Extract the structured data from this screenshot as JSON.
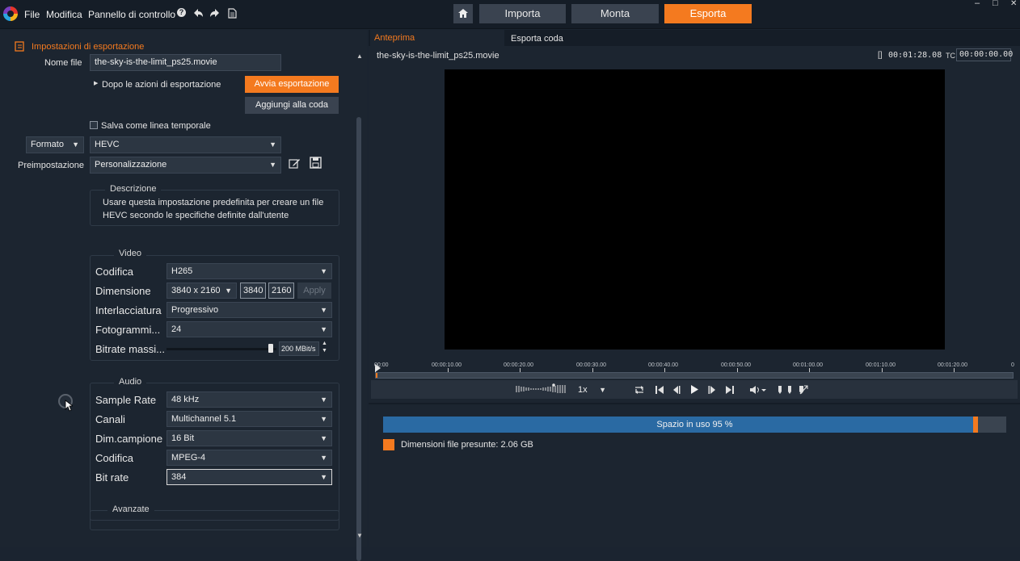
{
  "titlebar": {
    "menu": [
      "File",
      "Modifica",
      "Pannello di controllo"
    ],
    "tabs": [
      {
        "label": "Importa",
        "active": false
      },
      {
        "label": "Monta",
        "active": false
      },
      {
        "label": "Esporta",
        "active": true
      }
    ],
    "window_controls": {
      "minimize": "–",
      "maximize": "□",
      "close": "✕"
    }
  },
  "export_settings": {
    "header": "Impostazioni di esportazione",
    "file_name_label": "Nome file",
    "file_name_value": "the-sky-is-the-limit_ps25.movie",
    "after_export_actions": "Dopo le azioni di esportazione",
    "start_export_button": "Avvia esportazione",
    "add_to_queue_button": "Aggiungi alla coda",
    "save_as_timeline": "Salva come linea temporale",
    "save_as_timeline_checked": false,
    "format_label": "Formato",
    "format_value": "HEVC",
    "preset_label": "Preimpostazione",
    "preset_value": "Personalizzazione",
    "description_title": "Descrizione",
    "description_text_1": "Usare questa impostazione predefinita per creare un file",
    "description_text_2": "HEVC secondo le specifiche definite dall'utente"
  },
  "video": {
    "title": "Video",
    "codec_label": "Codifica",
    "codec_value": "H265",
    "size_label": "Dimensione",
    "size_value": "3840 x 2160",
    "width_value": "3840",
    "height_value": "2160",
    "apply_button": "Apply",
    "interlace_label": "Interlacciatura",
    "interlace_value": "Progressivo",
    "framerate_label": "Fotogrammi...",
    "framerate_value": "24",
    "bitrate_label": "Bitrate massi...",
    "bitrate_value": "200 MBit/s",
    "bitrate_fraction": 0.95
  },
  "audio": {
    "title": "Audio",
    "sample_rate_label": "Sample Rate",
    "sample_rate_value": "48 kHz",
    "channels_label": "Canali",
    "channels_value": "Multichannel 5.1",
    "sample_size_label": "Dim.campione",
    "sample_size_value": "16 Bit",
    "codec_label": "Codifica",
    "codec_value": "MPEG-4",
    "bitrate_label": "Bit rate",
    "bitrate_value": "384"
  },
  "advanced": {
    "title": "Avanzate"
  },
  "preview": {
    "tabs": [
      {
        "label": "Anteprima",
        "active": true
      },
      {
        "label": "Esporta coda",
        "active": false
      }
    ],
    "file_name": "the-sky-is-the-limit_ps25.movie",
    "duration_prefix": "[]",
    "duration": "00:01:28.08",
    "tc_label": "TC",
    "timecode": "00:00:00.00",
    "timeline_ticks": [
      "00:00",
      "00:00:10.00",
      "00:00:20.00",
      "00:00:30.00",
      "00:00:40.00",
      "00:00:50.00",
      "00:01:00.00",
      "00:01:10.00",
      "00:01:20.00",
      "0"
    ],
    "speed_value": "1x"
  },
  "storage": {
    "label": "Spazio in uso 95 %",
    "used_fraction": 0.95,
    "legend_label": "Dimensioni file presunte: 2.06 GB",
    "bar_color": "#2a6aa3",
    "marker_color": "#f47a1f"
  }
}
